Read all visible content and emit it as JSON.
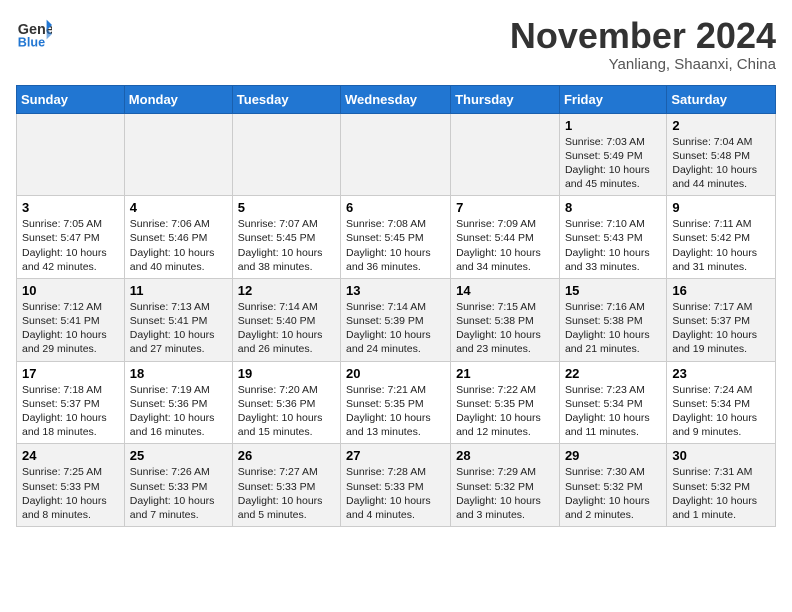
{
  "header": {
    "logo_line1": "General",
    "logo_line2": "Blue",
    "month": "November 2024",
    "location": "Yanliang, Shaanxi, China"
  },
  "weekdays": [
    "Sunday",
    "Monday",
    "Tuesday",
    "Wednesday",
    "Thursday",
    "Friday",
    "Saturday"
  ],
  "weeks": [
    [
      {
        "day": "",
        "info": ""
      },
      {
        "day": "",
        "info": ""
      },
      {
        "day": "",
        "info": ""
      },
      {
        "day": "",
        "info": ""
      },
      {
        "day": "",
        "info": ""
      },
      {
        "day": "1",
        "info": "Sunrise: 7:03 AM\nSunset: 5:49 PM\nDaylight: 10 hours\nand 45 minutes."
      },
      {
        "day": "2",
        "info": "Sunrise: 7:04 AM\nSunset: 5:48 PM\nDaylight: 10 hours\nand 44 minutes."
      }
    ],
    [
      {
        "day": "3",
        "info": "Sunrise: 7:05 AM\nSunset: 5:47 PM\nDaylight: 10 hours\nand 42 minutes."
      },
      {
        "day": "4",
        "info": "Sunrise: 7:06 AM\nSunset: 5:46 PM\nDaylight: 10 hours\nand 40 minutes."
      },
      {
        "day": "5",
        "info": "Sunrise: 7:07 AM\nSunset: 5:45 PM\nDaylight: 10 hours\nand 38 minutes."
      },
      {
        "day": "6",
        "info": "Sunrise: 7:08 AM\nSunset: 5:45 PM\nDaylight: 10 hours\nand 36 minutes."
      },
      {
        "day": "7",
        "info": "Sunrise: 7:09 AM\nSunset: 5:44 PM\nDaylight: 10 hours\nand 34 minutes."
      },
      {
        "day": "8",
        "info": "Sunrise: 7:10 AM\nSunset: 5:43 PM\nDaylight: 10 hours\nand 33 minutes."
      },
      {
        "day": "9",
        "info": "Sunrise: 7:11 AM\nSunset: 5:42 PM\nDaylight: 10 hours\nand 31 minutes."
      }
    ],
    [
      {
        "day": "10",
        "info": "Sunrise: 7:12 AM\nSunset: 5:41 PM\nDaylight: 10 hours\nand 29 minutes."
      },
      {
        "day": "11",
        "info": "Sunrise: 7:13 AM\nSunset: 5:41 PM\nDaylight: 10 hours\nand 27 minutes."
      },
      {
        "day": "12",
        "info": "Sunrise: 7:14 AM\nSunset: 5:40 PM\nDaylight: 10 hours\nand 26 minutes."
      },
      {
        "day": "13",
        "info": "Sunrise: 7:14 AM\nSunset: 5:39 PM\nDaylight: 10 hours\nand 24 minutes."
      },
      {
        "day": "14",
        "info": "Sunrise: 7:15 AM\nSunset: 5:38 PM\nDaylight: 10 hours\nand 23 minutes."
      },
      {
        "day": "15",
        "info": "Sunrise: 7:16 AM\nSunset: 5:38 PM\nDaylight: 10 hours\nand 21 minutes."
      },
      {
        "day": "16",
        "info": "Sunrise: 7:17 AM\nSunset: 5:37 PM\nDaylight: 10 hours\nand 19 minutes."
      }
    ],
    [
      {
        "day": "17",
        "info": "Sunrise: 7:18 AM\nSunset: 5:37 PM\nDaylight: 10 hours\nand 18 minutes."
      },
      {
        "day": "18",
        "info": "Sunrise: 7:19 AM\nSunset: 5:36 PM\nDaylight: 10 hours\nand 16 minutes."
      },
      {
        "day": "19",
        "info": "Sunrise: 7:20 AM\nSunset: 5:36 PM\nDaylight: 10 hours\nand 15 minutes."
      },
      {
        "day": "20",
        "info": "Sunrise: 7:21 AM\nSunset: 5:35 PM\nDaylight: 10 hours\nand 13 minutes."
      },
      {
        "day": "21",
        "info": "Sunrise: 7:22 AM\nSunset: 5:35 PM\nDaylight: 10 hours\nand 12 minutes."
      },
      {
        "day": "22",
        "info": "Sunrise: 7:23 AM\nSunset: 5:34 PM\nDaylight: 10 hours\nand 11 minutes."
      },
      {
        "day": "23",
        "info": "Sunrise: 7:24 AM\nSunset: 5:34 PM\nDaylight: 10 hours\nand 9 minutes."
      }
    ],
    [
      {
        "day": "24",
        "info": "Sunrise: 7:25 AM\nSunset: 5:33 PM\nDaylight: 10 hours\nand 8 minutes."
      },
      {
        "day": "25",
        "info": "Sunrise: 7:26 AM\nSunset: 5:33 PM\nDaylight: 10 hours\nand 7 minutes."
      },
      {
        "day": "26",
        "info": "Sunrise: 7:27 AM\nSunset: 5:33 PM\nDaylight: 10 hours\nand 5 minutes."
      },
      {
        "day": "27",
        "info": "Sunrise: 7:28 AM\nSunset: 5:33 PM\nDaylight: 10 hours\nand 4 minutes."
      },
      {
        "day": "28",
        "info": "Sunrise: 7:29 AM\nSunset: 5:32 PM\nDaylight: 10 hours\nand 3 minutes."
      },
      {
        "day": "29",
        "info": "Sunrise: 7:30 AM\nSunset: 5:32 PM\nDaylight: 10 hours\nand 2 minutes."
      },
      {
        "day": "30",
        "info": "Sunrise: 7:31 AM\nSunset: 5:32 PM\nDaylight: 10 hours\nand 1 minute."
      }
    ]
  ]
}
